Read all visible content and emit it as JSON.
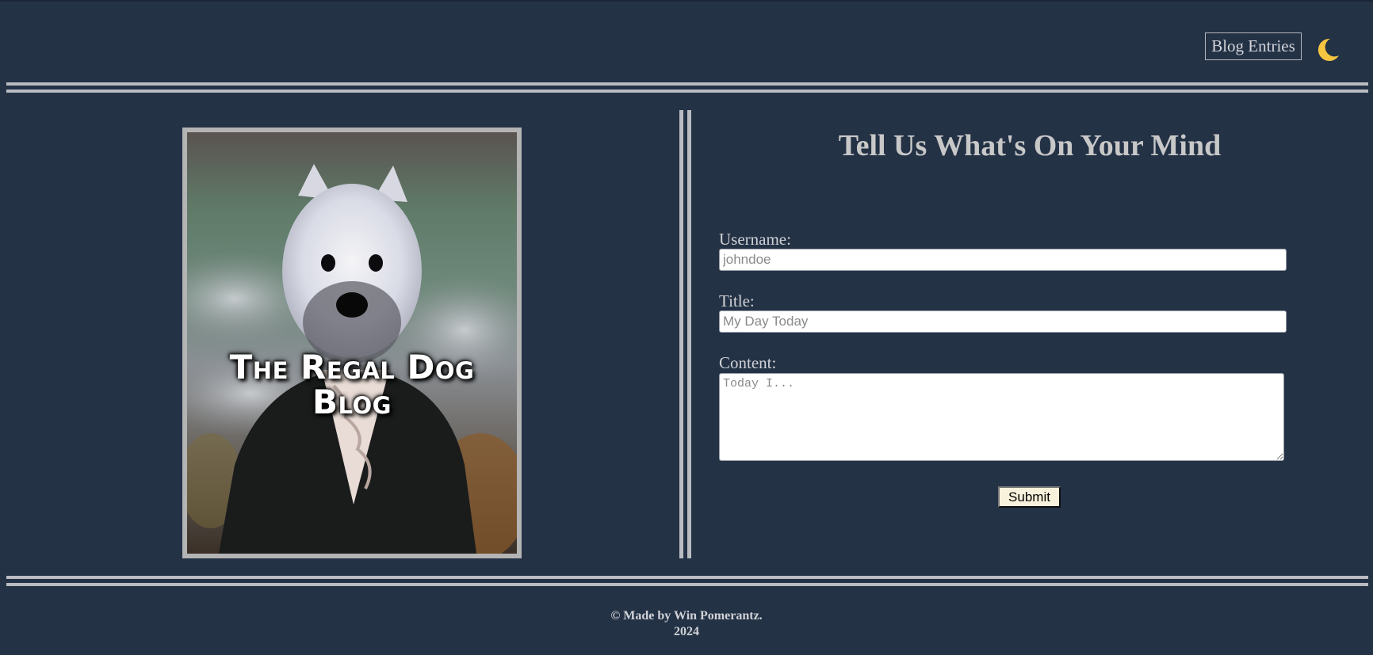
{
  "header": {
    "nav_link": "Blog Entries",
    "theme_toggle_icon": "moon-icon"
  },
  "portrait": {
    "title_line1": "The Regal Dog",
    "title_line2": "Blog"
  },
  "form": {
    "heading": "Tell Us What's On Your Mind",
    "username_label": "Username:",
    "username_placeholder": "johndoe",
    "title_label": "Title:",
    "title_placeholder": "My Day Today",
    "content_label": "Content:",
    "content_placeholder": "Today I...",
    "submit_label": "Submit"
  },
  "footer": {
    "line1": "© Made by Win Pomerantz.",
    "line2": "2024"
  },
  "colors": {
    "background": "#243246",
    "rule": "#b9bcc1",
    "text": "#c8c8c8",
    "moon": "#f5c542",
    "submit_bg": "#f8f2dc"
  }
}
